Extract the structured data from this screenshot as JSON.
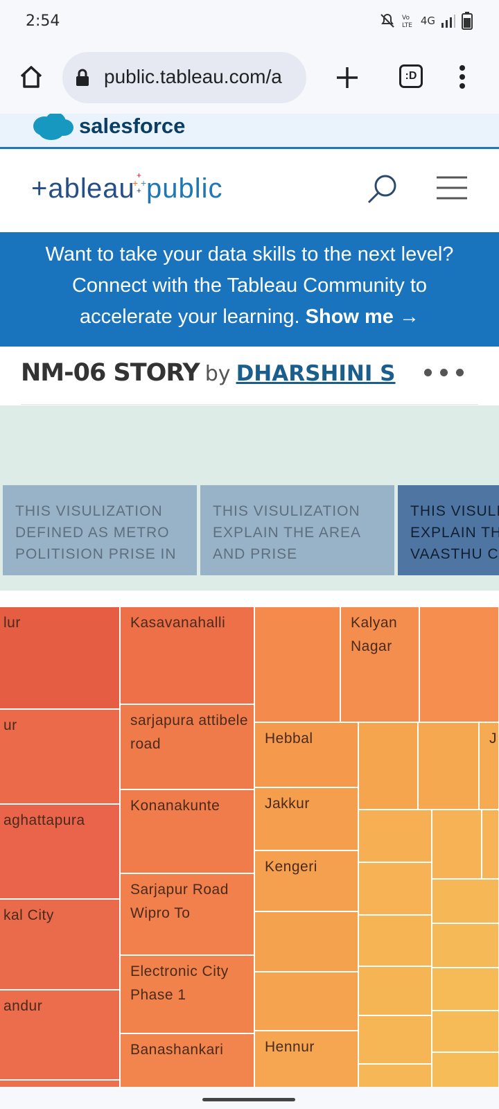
{
  "status_bar": {
    "time": "2:54",
    "network": "4G"
  },
  "browser": {
    "url": "public.tableau.com/a",
    "tab_count": ":D"
  },
  "salesforce_bar": {
    "label": "salesforce"
  },
  "header": {
    "logo_text": "+ableau+public"
  },
  "banner": {
    "line1": "Want to take your data skills to the next level?",
    "line2": "Connect with the Tableau Community to",
    "line3": "accelerate your learning.",
    "link": "Show me →"
  },
  "story": {
    "title": "NM-06 STORY",
    "by": "by",
    "author": "DHARSHINI S"
  },
  "story_points": [
    {
      "lines": [
        "THIS VISULIZATION",
        "DEFINED AS METRO",
        "POLITISION PRISE IN"
      ]
    },
    {
      "lines": [
        "THIS VISULIZATION",
        "EXPLAIN THE AREA",
        "AND PRISE"
      ]
    },
    {
      "lines": [
        "THIS VISULIZ",
        "EXPLAIN TH",
        "VAASTHU CO"
      ]
    }
  ],
  "treemap_labels": {
    "c1": "lur",
    "c2": "ur",
    "c3": "aghattapura",
    "c4": "kal City",
    "c5": "andur",
    "kasavanahalli": "Kasavanahalli",
    "sarjapura": "sarjapura attibele road",
    "konanakunte": "Konanakunte",
    "sarjapur_wipro": "Sarjapur Road Wipro To",
    "electronic_city": "Electronic City Phase 1",
    "banashankari": "Banashankari",
    "kalyan_nagar": "Kalyan Nagar",
    "hebbal": "Hebbal",
    "jakkur": "Jakkur",
    "kengeri": "Kengeri",
    "hennur": "Hennur",
    "j_partial": "J"
  },
  "colors": {
    "banner_bg": "#1a74bd",
    "story_point_light": "#98b3c8",
    "story_point_active": "#4f76a3",
    "treemap_red": "#e55e44",
    "treemap_orange": "#f48b4c",
    "treemap_yellow": "#f6bb57"
  }
}
